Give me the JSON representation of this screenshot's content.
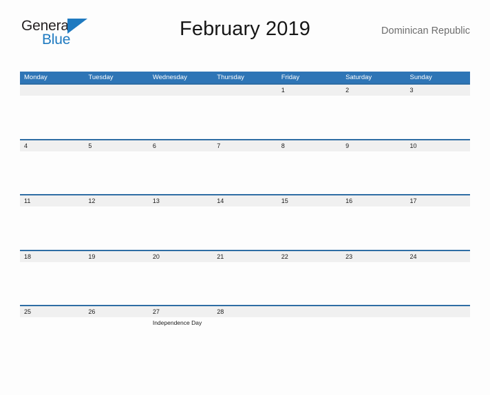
{
  "brand": {
    "name_part1": "General",
    "name_part2": "Blue",
    "flag_icon": "blue-flag-triangle-icon",
    "color_primary": "#1f7ac0",
    "color_text": "#231f20"
  },
  "header": {
    "title": "February 2019",
    "country": "Dominican Republic"
  },
  "calendar": {
    "header_bg": "#2e75b6",
    "row_divider": "#2e6da4",
    "date_band_bg": "#f0f0f0",
    "weekdays": [
      "Monday",
      "Tuesday",
      "Wednesday",
      "Thursday",
      "Friday",
      "Saturday",
      "Sunday"
    ],
    "weeks": [
      {
        "days": [
          {
            "num": "",
            "event": ""
          },
          {
            "num": "",
            "event": ""
          },
          {
            "num": "",
            "event": ""
          },
          {
            "num": "",
            "event": ""
          },
          {
            "num": "1",
            "event": ""
          },
          {
            "num": "2",
            "event": ""
          },
          {
            "num": "3",
            "event": ""
          }
        ]
      },
      {
        "days": [
          {
            "num": "4",
            "event": ""
          },
          {
            "num": "5",
            "event": ""
          },
          {
            "num": "6",
            "event": ""
          },
          {
            "num": "7",
            "event": ""
          },
          {
            "num": "8",
            "event": ""
          },
          {
            "num": "9",
            "event": ""
          },
          {
            "num": "10",
            "event": ""
          }
        ]
      },
      {
        "days": [
          {
            "num": "11",
            "event": ""
          },
          {
            "num": "12",
            "event": ""
          },
          {
            "num": "13",
            "event": ""
          },
          {
            "num": "14",
            "event": ""
          },
          {
            "num": "15",
            "event": ""
          },
          {
            "num": "16",
            "event": ""
          },
          {
            "num": "17",
            "event": ""
          }
        ]
      },
      {
        "days": [
          {
            "num": "18",
            "event": ""
          },
          {
            "num": "19",
            "event": ""
          },
          {
            "num": "20",
            "event": ""
          },
          {
            "num": "21",
            "event": ""
          },
          {
            "num": "22",
            "event": ""
          },
          {
            "num": "23",
            "event": ""
          },
          {
            "num": "24",
            "event": ""
          }
        ]
      },
      {
        "days": [
          {
            "num": "25",
            "event": ""
          },
          {
            "num": "26",
            "event": ""
          },
          {
            "num": "27",
            "event": "Independence Day"
          },
          {
            "num": "28",
            "event": ""
          },
          {
            "num": "",
            "event": ""
          },
          {
            "num": "",
            "event": ""
          },
          {
            "num": "",
            "event": ""
          }
        ]
      }
    ]
  }
}
